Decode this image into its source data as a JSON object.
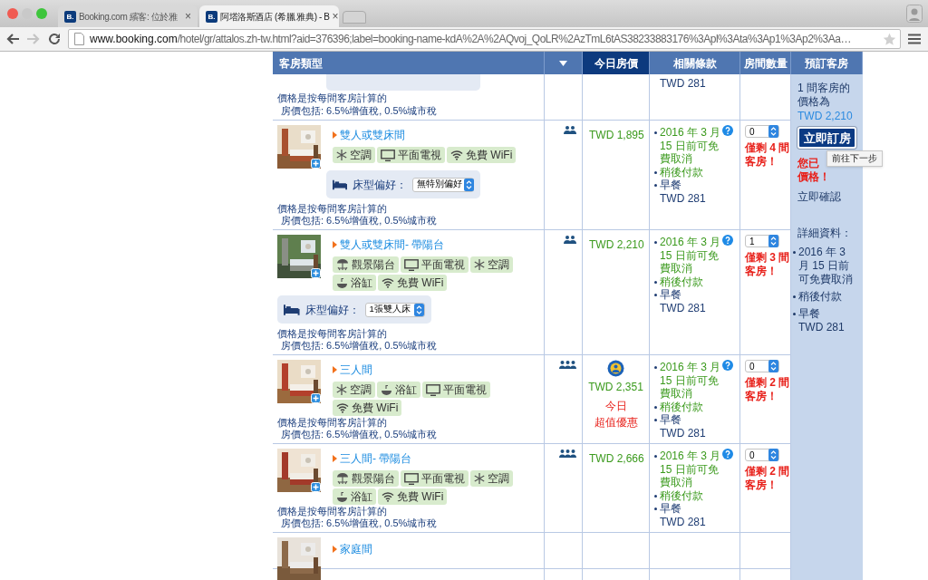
{
  "browser": {
    "tabs": [
      {
        "favicon": "B.",
        "title": "Booking.com 繽客: 位於雅",
        "close": "×",
        "selected": false
      },
      {
        "favicon": "B.",
        "title": "阿塔洛斯酒店 (希臘 雅典) - B",
        "close": "×",
        "selected": true
      }
    ],
    "nav": {
      "back_disabled": false,
      "forward_disabled": true
    },
    "url": {
      "host": "www.booking.com",
      "path": "/hotel/gr/attalos.zh-tw.html?aid=376396;label=booking-name-kdA%2A%2AQvoj_QoLR%2AzTmL6tAS38233883176%3Apl%3Ata%3Ap1%3Ap2%3Aa…"
    }
  },
  "table": {
    "columns": [
      {
        "kind": "text",
        "label": "客房類型",
        "selected": false
      },
      {
        "kind": "dropdown",
        "selected": false
      },
      {
        "kind": "text",
        "label": "今日房價",
        "selected": true
      },
      {
        "kind": "text",
        "label": "相關條款",
        "selected": false
      },
      {
        "kind": "text",
        "label": "房間數量",
        "selected": false
      },
      {
        "kind": "text",
        "label": "預訂客房",
        "selected": false
      }
    ],
    "continued_row": {
      "notes": [
        "價格是按每間客房計算的",
        "房價包括: 6.5%增值稅, 0.5%城市稅"
      ],
      "meal_price": "TWD 281"
    },
    "rooms": [
      {
        "name": "雙人或雙床間",
        "occupancy": {
          "kind": "double"
        },
        "amenities": [
          {
            "kind": "ac",
            "label": "空調"
          },
          {
            "kind": "tv",
            "label": "平面電視"
          },
          {
            "kind": "wifi",
            "label": "免費 WiFi"
          }
        ],
        "bed_preference": {
          "label": "床型偏好：",
          "value": "無特別偏好"
        },
        "notes": [
          "價格是按每間客房計算的",
          "房價包括: 6.5%增值稅, 0.5%城市稅"
        ],
        "price": "TWD 1,895",
        "deal": false,
        "terms": [
          {
            "kind": "cancel",
            "text": "2016 年 3 月 15 日前可免費取消"
          },
          {
            "kind": "pay",
            "text": "稍後付款"
          },
          {
            "kind": "meal",
            "text": "早餐",
            "price": "TWD 281"
          }
        ],
        "quantity": "0",
        "availability": "僅剩 4 間客房！"
      },
      {
        "name": "雙人或雙床間- 帶陽台",
        "occupancy": {
          "kind": "double"
        },
        "amenities": [
          {
            "kind": "balcony",
            "label": "觀景陽台"
          },
          {
            "kind": "tv",
            "label": "平面電視"
          },
          {
            "kind": "ac",
            "label": "空調"
          },
          {
            "kind": "bath",
            "label": "浴缸"
          },
          {
            "kind": "wifi",
            "label": "免費 WiFi"
          }
        ],
        "bed_preference": {
          "label": "床型偏好：",
          "value": "1張雙人床"
        },
        "notes": [
          "價格是按每間客房計算的",
          "房價包括: 6.5%增值稅, 0.5%城市稅"
        ],
        "price": "TWD 2,210",
        "deal": false,
        "terms": [
          {
            "kind": "cancel",
            "text": "2016 年 3 月 15 日前可免費取消"
          },
          {
            "kind": "pay",
            "text": "稍後付款"
          },
          {
            "kind": "meal",
            "text": "早餐",
            "price": "TWD 281"
          }
        ],
        "quantity": "1",
        "availability": "僅剩 3 間客房！"
      },
      {
        "name": "三人間",
        "occupancy": {
          "kind": "triple"
        },
        "amenities": [
          {
            "kind": "ac",
            "label": "空調"
          },
          {
            "kind": "bath",
            "label": "浴缸"
          },
          {
            "kind": "tv",
            "label": "平面電視"
          },
          {
            "kind": "wifi",
            "label": "免費 WiFi"
          }
        ],
        "notes": [
          "價格是按每間客房計算的",
          "房價包括: 6.5%增值稅, 0.5%城市稅"
        ],
        "price": "TWD 2,351",
        "deal": true,
        "deal_label": [
          "今日",
          "超值優惠"
        ],
        "terms": [
          {
            "kind": "cancel",
            "text": "2016 年 3 月 15 日前可免費取消"
          },
          {
            "kind": "pay",
            "text": "稍後付款"
          },
          {
            "kind": "meal",
            "text": "早餐",
            "price": "TWD 281"
          }
        ],
        "quantity": "0",
        "availability": "僅剩 2 間客房！"
      },
      {
        "name": "三人間- 帶陽台",
        "occupancy": {
          "kind": "triple"
        },
        "amenities": [
          {
            "kind": "balcony",
            "label": "觀景陽台"
          },
          {
            "kind": "tv",
            "label": "平面電視"
          },
          {
            "kind": "ac",
            "label": "空調"
          },
          {
            "kind": "bath",
            "label": "浴缸"
          },
          {
            "kind": "wifi",
            "label": "免費 WiFi"
          }
        ],
        "notes": [
          "價格是按每間客房計算的",
          "房價包括: 6.5%增值稅, 0.5%城市稅"
        ],
        "price": "TWD 2,666",
        "deal": false,
        "terms": [
          {
            "kind": "cancel",
            "text": "2016 年 3 月 15 日前可免費取消"
          },
          {
            "kind": "pay",
            "text": "稍後付款"
          },
          {
            "kind": "meal",
            "text": "早餐",
            "price": "TWD 281"
          }
        ],
        "quantity": "0",
        "availability": "僅剩 2 間客房！"
      }
    ],
    "last_row": {
      "name": "家庭間"
    }
  },
  "booking_panel": {
    "price_label": "1 間客房的價格為",
    "price": "TWD 2,210",
    "button": "立即訂房",
    "tooltip": "前往下一步",
    "notice": [
      "您已",
      "價格！"
    ],
    "confirm": "立即確認",
    "details_title": "詳細資料：",
    "details": [
      {
        "kind": "cancel",
        "text": "2016 年 3 月 15 日前可免費取消"
      },
      {
        "kind": "pay",
        "text": "稍後付款"
      },
      {
        "kind": "meal",
        "text": "早餐",
        "price": "TWD 281"
      }
    ]
  }
}
